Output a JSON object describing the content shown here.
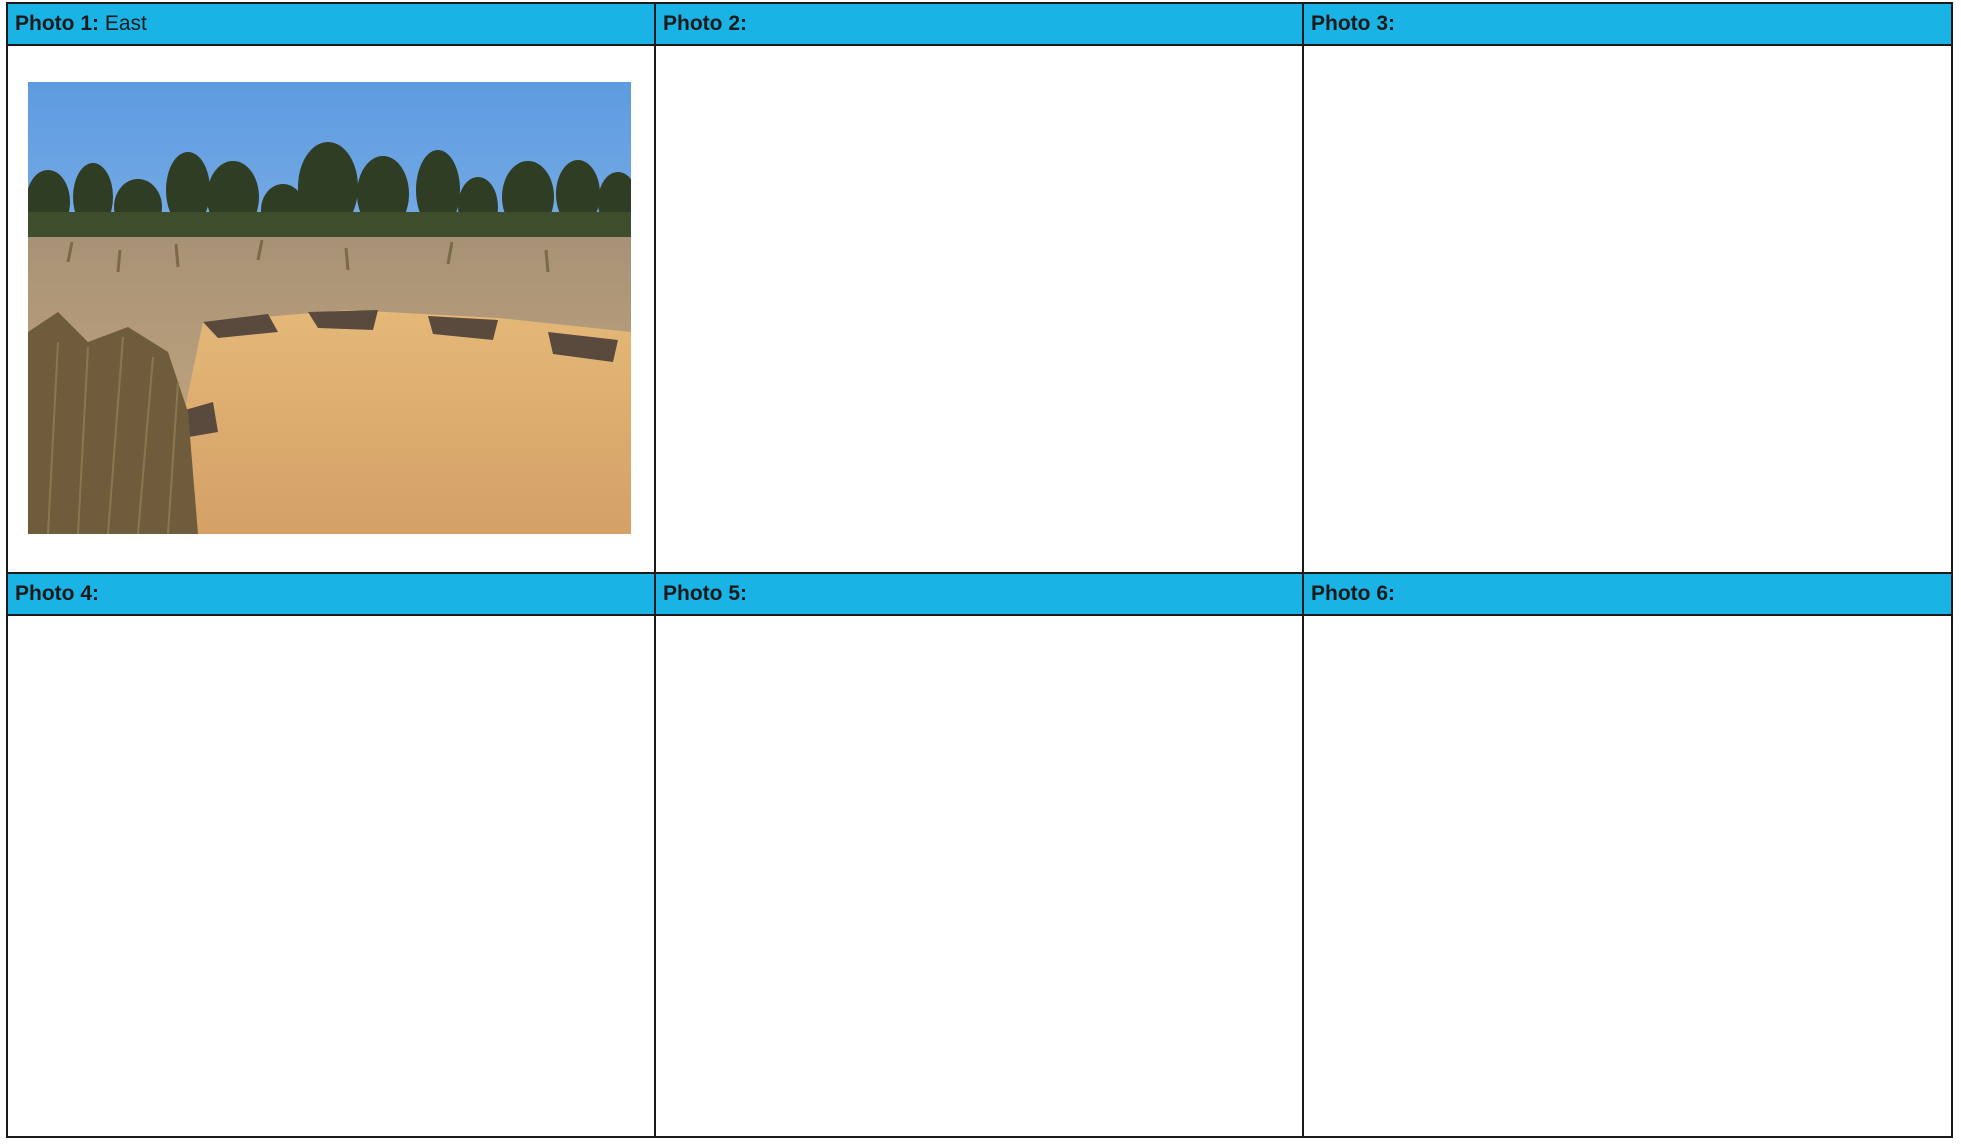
{
  "photos": [
    {
      "label": "Photo 1:",
      "caption": "East"
    },
    {
      "label": "Photo 2:",
      "caption": ""
    },
    {
      "label": "Photo 3:",
      "caption": ""
    },
    {
      "label": "Photo 4:",
      "caption": ""
    },
    {
      "label": "Photo 5:",
      "caption": ""
    },
    {
      "label": "Photo 6:",
      "caption": ""
    }
  ],
  "colors": {
    "header_bg": "#19b3e6",
    "border": "#1a1a1a"
  }
}
